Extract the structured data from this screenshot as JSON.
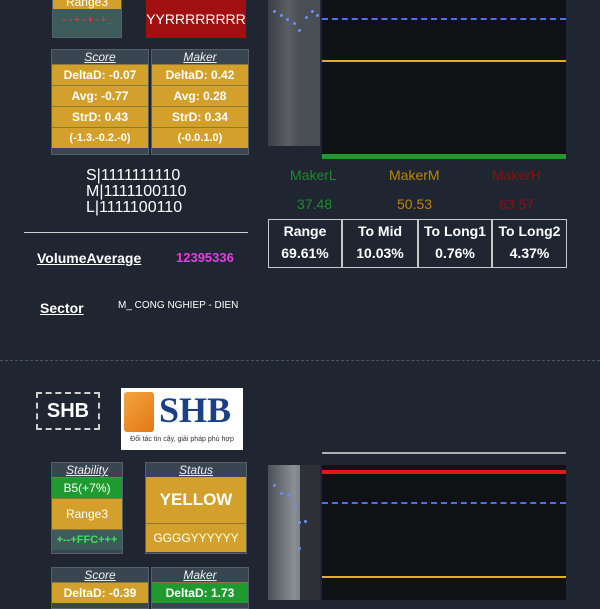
{
  "top": {
    "range_card": {
      "label": "Range3",
      "indicator": "--+-+-+_"
    },
    "signal_card": {
      "value": "YYRRRRRRRR"
    },
    "score": {
      "title": "Score",
      "deltad": "DeltaD: -0.07",
      "avg": "Avg: -0.77",
      "strd": "StrD: 0.43",
      "tuple": "(-1.3.-0.2.-0)"
    },
    "maker": {
      "title": "Maker",
      "deltad": "DeltaD: 0.42",
      "avg": "Avg: 0.28",
      "strd": "StrD: 0.34",
      "tuple": "(-0.0.1.0)"
    },
    "bits": {
      "s": "S|1111111110",
      "m": "M|1111100110",
      "l": "L|1111100110"
    },
    "volume": {
      "label": "VolumeAverage",
      "value": "12395336"
    },
    "sector": {
      "label": "Sector",
      "value": "M_ CONG NGHIEP - DIEN"
    },
    "makers": [
      {
        "name": "MakerL",
        "value": "37.48",
        "color": "#1f8a2a"
      },
      {
        "name": "MakerM",
        "value": "50.53",
        "color": "#b8860b"
      },
      {
        "name": "MakerH",
        "value": "63.57",
        "color": "#8b1010"
      }
    ],
    "table": [
      {
        "head": "Range",
        "val": "69.61%"
      },
      {
        "head": "To Mid",
        "val": "10.03%"
      },
      {
        "head": "To Long1",
        "val": "0.76%"
      },
      {
        "head": "To Long2",
        "val": "4.37%"
      }
    ]
  },
  "bottom": {
    "ticker": "SHB",
    "logo": {
      "text": "SHB",
      "slogan": "Đối tác tin cậy, giải pháp phù hợp"
    },
    "stability": {
      "title": "Stability",
      "value": "B5(+7%)",
      "range": "Range3",
      "indicator": "+--+FFC+++"
    },
    "status": {
      "title": "Status",
      "value": "YELLOW",
      "pattern": "GGGGYYYYYY"
    },
    "score": {
      "title": "Score",
      "deltad": "DeltaD: -0.39"
    },
    "maker": {
      "title": "Maker",
      "deltad": "DeltaD: 1.73"
    }
  },
  "colors": {
    "gold": "#d3a12b",
    "green": "#1f9a2f",
    "red": "#a01010",
    "yellow_line": "#e0b020",
    "dash_blue": "#4e6eff",
    "magenta": "#e040e0"
  }
}
